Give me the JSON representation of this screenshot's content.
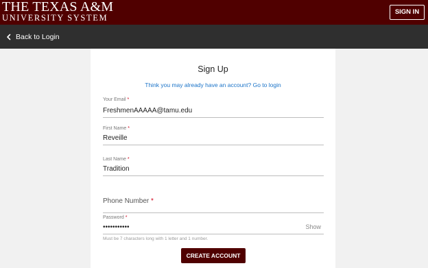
{
  "header": {
    "logo_line1": "THE TEXAS A&M",
    "logo_line2": "UNIVERSITY SYSTEM",
    "signin_label": "SIGN IN",
    "brand_color": "#500000"
  },
  "subnav": {
    "back_label": "Back to Login",
    "back_icon": "chevron-left-icon"
  },
  "form": {
    "title": "Sign Up",
    "login_prompt": "Think you may already have an account? Go to login",
    "required_marker": "*",
    "email": {
      "label": "Your Email",
      "value": "FreshmenAAAAA@tamu.edu"
    },
    "first_name": {
      "label": "First Name",
      "value": "Reveille"
    },
    "last_name": {
      "label": "Last Name",
      "value": "Tradition"
    },
    "phone": {
      "label": "Phone Number",
      "value": ""
    },
    "password": {
      "label": "Password",
      "value": "•••••••••••",
      "show_label": "Show",
      "hint": "Must be 7 characters long with 1 letter and 1 number."
    },
    "submit_label": "CREATE ACCOUNT"
  }
}
